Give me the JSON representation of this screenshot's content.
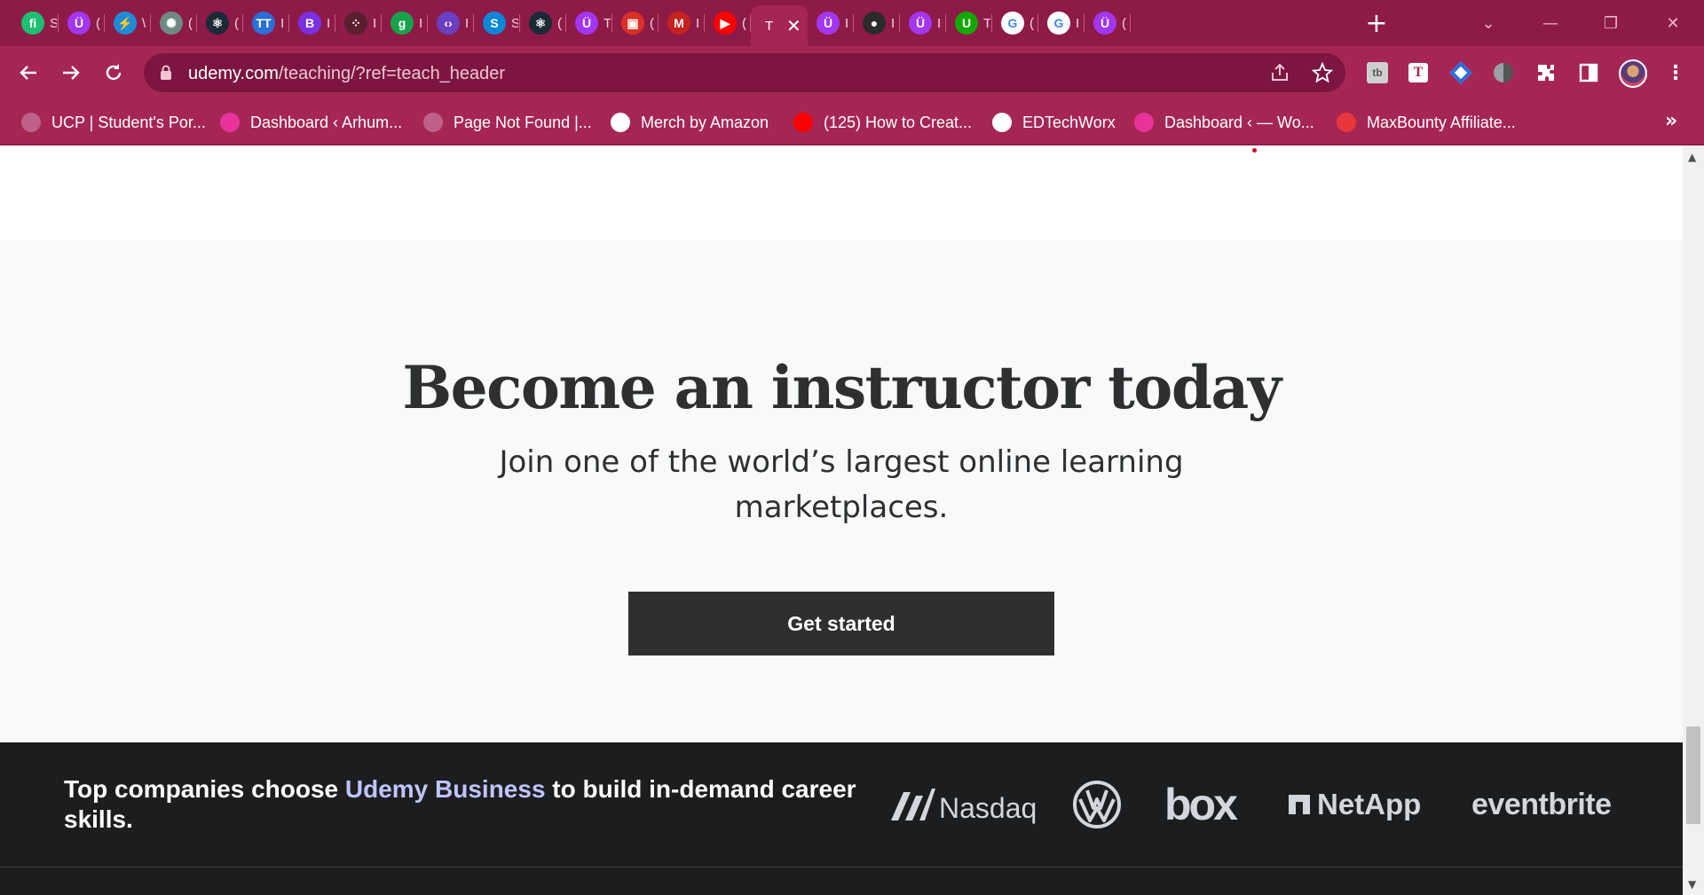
{
  "browser": {
    "tabs": [
      {
        "icon": "fiverr-icon",
        "glyph": "fi",
        "color": "#1dbf73",
        "title": "S"
      },
      {
        "icon": "udemy-icon",
        "glyph": "Ü",
        "color": "#a435f0",
        "title": "("
      },
      {
        "icon": "flutter-icon",
        "glyph": "⚡",
        "color": "#1c8cd9",
        "title": "\\"
      },
      {
        "icon": "chatgpt-icon",
        "glyph": "✺",
        "color": "#6e8a82",
        "title": "("
      },
      {
        "icon": "react-icon",
        "glyph": "⚛",
        "color": "#1b2a35",
        "title": "("
      },
      {
        "icon": "tt-icon",
        "glyph": "TT",
        "color": "#2b6fd6",
        "title": "I"
      },
      {
        "icon": "bootstrap-icon",
        "glyph": "B",
        "color": "#7a2fe3",
        "title": "I"
      },
      {
        "icon": "dots-icon",
        "glyph": "⁘",
        "color": "#5a1f2e",
        "title": "I"
      },
      {
        "icon": "grammarly-icon",
        "glyph": "g",
        "color": "#16a34a",
        "title": "I"
      },
      {
        "icon": "code-icon",
        "glyph": "‹›",
        "color": "#6a3fc2",
        "title": "I"
      },
      {
        "icon": "skype-icon",
        "glyph": "S",
        "color": "#0b86d8",
        "title": "S"
      },
      {
        "icon": "react-icon",
        "glyph": "⚛",
        "color": "#1b2a35",
        "title": "("
      },
      {
        "icon": "udemy-icon",
        "glyph": "Ü",
        "color": "#a435f0",
        "title": "T"
      },
      {
        "icon": "meet-icon",
        "glyph": "▣",
        "color": "#d93025",
        "title": "("
      },
      {
        "icon": "gmail-icon",
        "glyph": "M",
        "color": "#c5221f",
        "title": "I"
      },
      {
        "icon": "youtube-icon",
        "glyph": "▶",
        "color": "#ff0000",
        "title": "("
      },
      {
        "icon": "udemy-teach-icon",
        "glyph": "T",
        "color": "#a52654",
        "title": "T",
        "active": true
      },
      {
        "icon": "udemy-icon",
        "glyph": "Ü",
        "color": "#a435f0",
        "title": "I"
      },
      {
        "icon": "github-icon",
        "glyph": "●",
        "color": "#2b2b2b",
        "title": "I"
      },
      {
        "icon": "udemy-icon",
        "glyph": "Ü",
        "color": "#a435f0",
        "title": "I"
      },
      {
        "icon": "upwork-icon",
        "glyph": "U",
        "color": "#14a800",
        "title": "T"
      },
      {
        "icon": "google-icon",
        "glyph": "G",
        "color": "#ffffff",
        "title": "("
      },
      {
        "icon": "google-icon",
        "glyph": "G",
        "color": "#ffffff",
        "title": "I"
      },
      {
        "icon": "udemy-icon",
        "glyph": "Ü",
        "color": "#a435f0",
        "title": "("
      }
    ],
    "url_host": "udemy.com",
    "url_path": "/teaching/?ref=teach_header",
    "bookmarks": [
      {
        "label": "UCP | Student's Por...",
        "icon": "ucp-icon",
        "color": "#c0608a"
      },
      {
        "label": "Dashboard ‹ Arhum...",
        "icon": "wp-icon",
        "color": "#e8349a"
      },
      {
        "label": "Page Not Found |...",
        "icon": "circle-icon",
        "color": "#c0608a"
      },
      {
        "label": "Merch by Amazon",
        "icon": "amazon-icon",
        "color": "#ffffff"
      },
      {
        "label": "(125) How to Creat...",
        "icon": "youtube-icon",
        "color": "#ff0000"
      },
      {
        "label": "EDTechWorx",
        "icon": "edtech-icon",
        "color": "#ffffff"
      },
      {
        "label": "Dashboard ‹ — Wo...",
        "icon": "wp-icon",
        "color": "#e8349a"
      },
      {
        "label": "MaxBounty Affiliate...",
        "icon": "maxbounty-icon",
        "color": "#e8363a"
      }
    ]
  },
  "cta": {
    "title": "Become an instructor today",
    "subtitle": "Join one of the world’s largest online learning marketplaces.",
    "button": "Get started"
  },
  "band": {
    "text_before": "Top companies choose ",
    "text_highlight": "Udemy Business",
    "text_after": " to build in-demand career skills.",
    "logos": [
      {
        "name": "Nasdaq",
        "icon": "nasdaq-logo"
      },
      {
        "name": "VW",
        "icon": "volkswagen-logo"
      },
      {
        "name": "box",
        "icon": "box-logo"
      },
      {
        "name": "NetApp",
        "icon": "netapp-logo"
      },
      {
        "name": "eventbrite",
        "icon": "eventbrite-logo"
      }
    ]
  },
  "colors": {
    "chrome": "#a52654",
    "tabbar": "#8e1a47",
    "accent": "#c0c4fc",
    "dark": "#2d2f31"
  }
}
